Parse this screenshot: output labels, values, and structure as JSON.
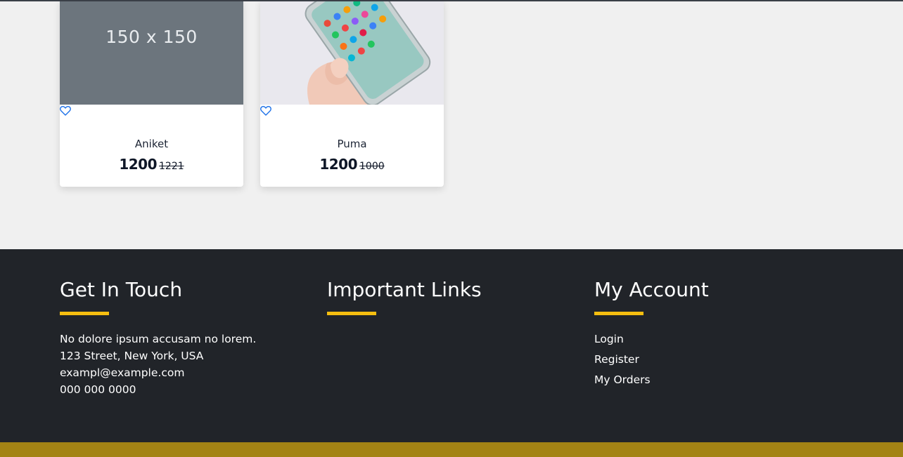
{
  "products": [
    {
      "name": "Aniket",
      "price": "1200",
      "old_price": "1221",
      "image_text": "150 x 150",
      "image_kind": "placeholder"
    },
    {
      "name": "Puma",
      "price": "1200",
      "old_price": "1000",
      "image_kind": "phone-photo"
    }
  ],
  "footer": {
    "contact": {
      "title": "Get In Touch",
      "description": "No dolore ipsum accusam no lorem.",
      "address": "123 Street, New York, USA",
      "email": "exampl@example.com",
      "phone": "000 000 0000"
    },
    "important_links": {
      "title": "Important Links"
    },
    "account": {
      "title": "My Account",
      "links": [
        "Login",
        "Register",
        "My Orders"
      ]
    }
  },
  "colors": {
    "footer_bg": "#212429",
    "accent": "#f5be10",
    "bottom_bar": "#a38314",
    "page_bg": "#f0f0f0"
  },
  "icons": {
    "wishlist": "heart-outline-icon"
  }
}
